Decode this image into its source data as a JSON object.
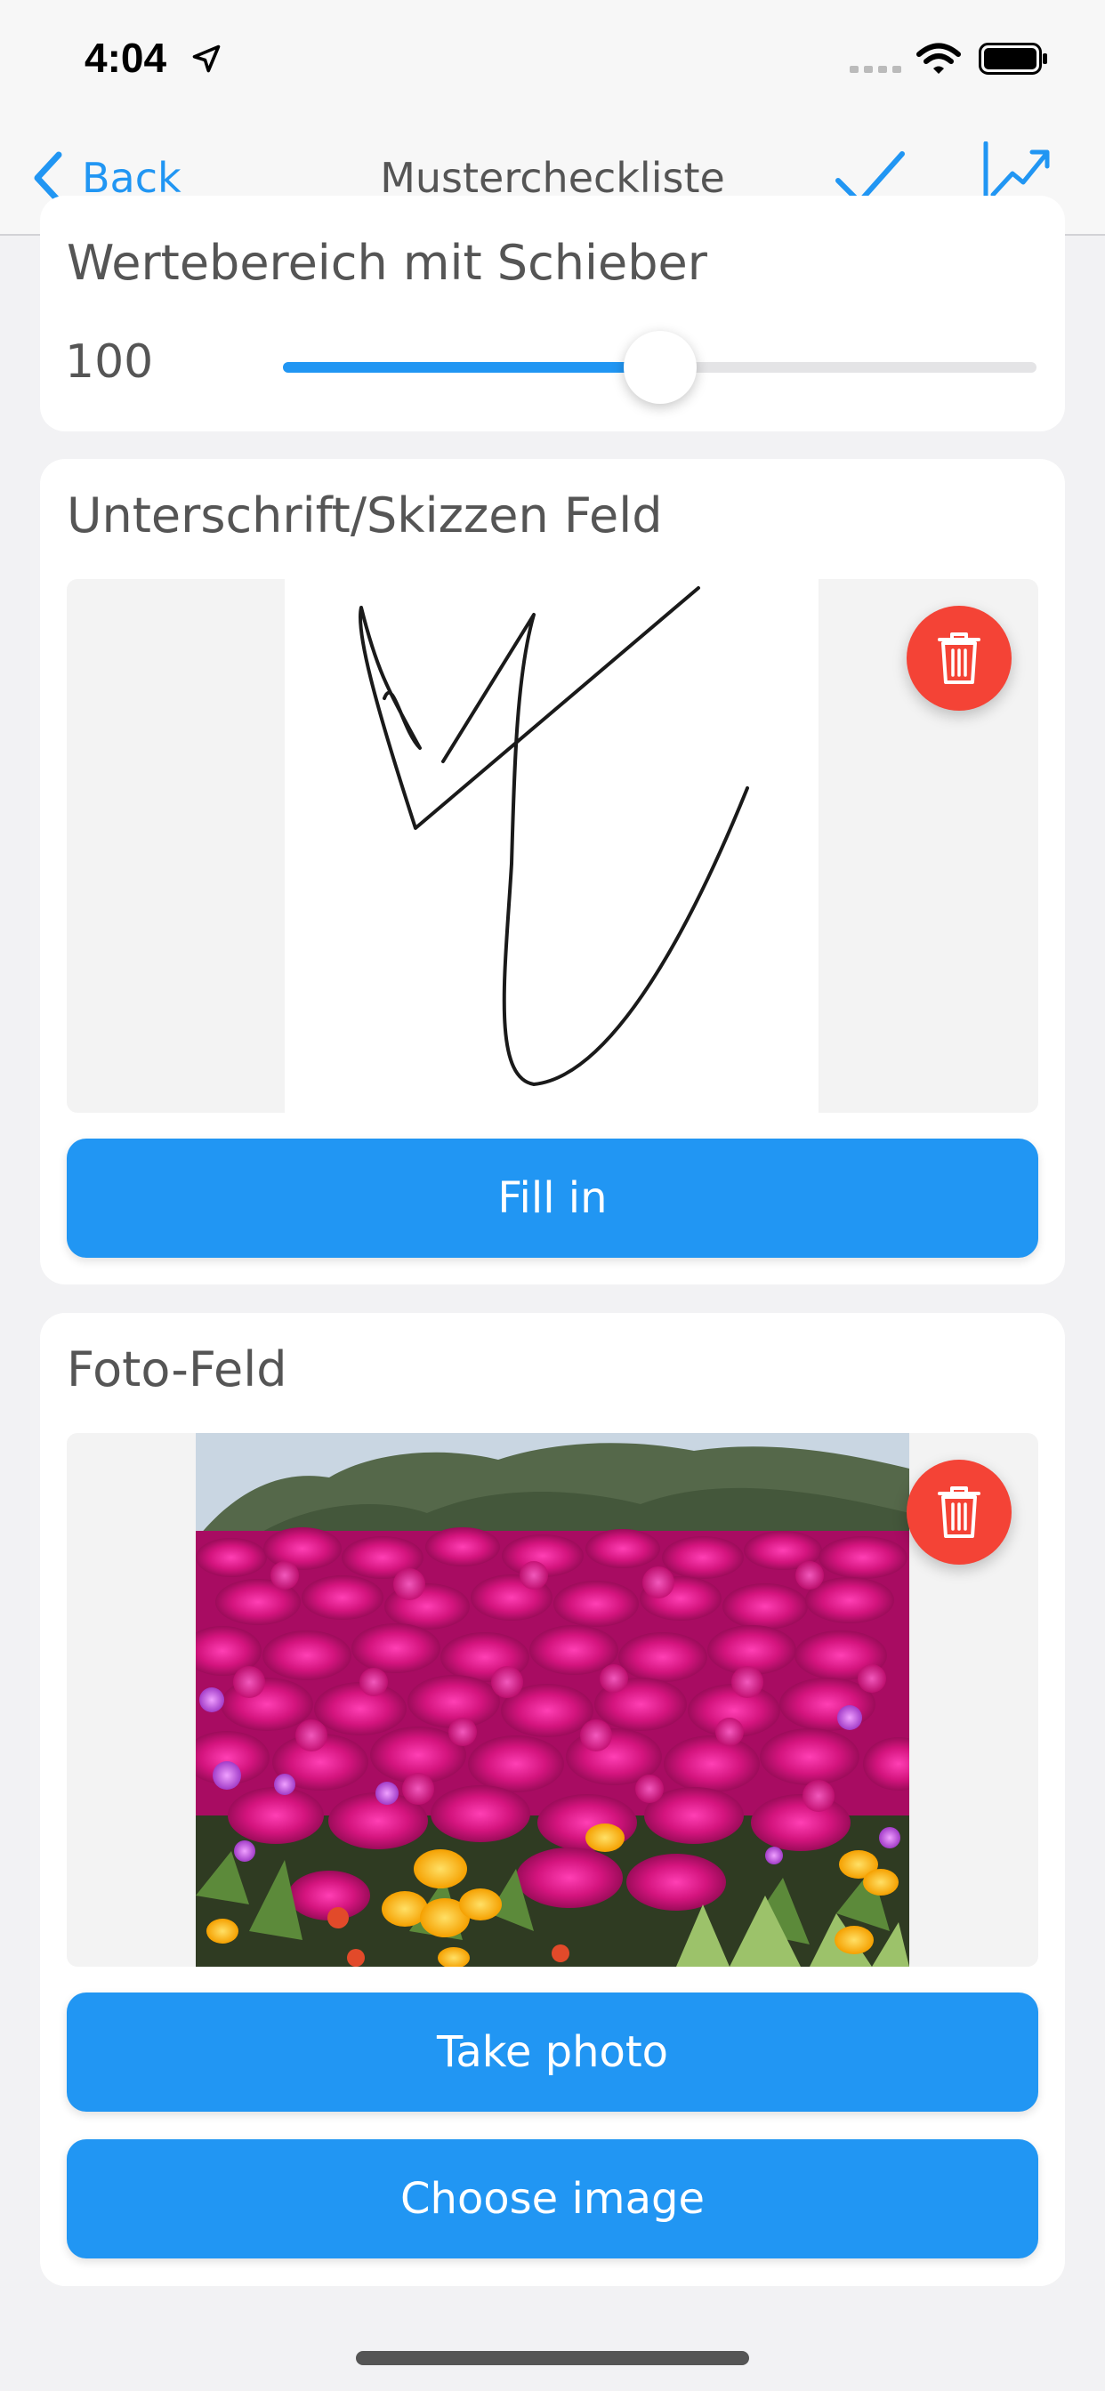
{
  "status_bar": {
    "time": "4:04",
    "icons": [
      "location-arrow-icon",
      "cellular-signal-icon",
      "wifi-icon",
      "battery-icon"
    ]
  },
  "nav": {
    "back_label": "Back",
    "title": "Mustercheckliste",
    "icons": [
      "chevron-left-icon",
      "checkmark-icon",
      "trend-chart-icon"
    ]
  },
  "slider_card": {
    "title": "Wertebereich mit Schieber",
    "value": "100",
    "fill_fraction": 0.5
  },
  "signature_card": {
    "title": "Unterschrift/Skizzen Feld",
    "fill_in_label": "Fill in"
  },
  "photo_card": {
    "title": "Foto-Feld",
    "take_photo_label": "Take photo",
    "choose_image_label": "Choose image"
  },
  "colors": {
    "accent": "#2196f3",
    "danger": "#f44336",
    "background": "#f2f2f4"
  }
}
